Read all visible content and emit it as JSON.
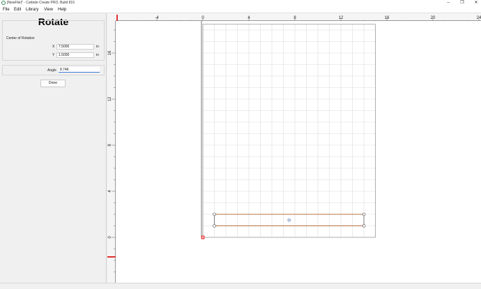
{
  "window": {
    "title": "[NewFile]* - Carbide Create PRO, Build 815",
    "minimize_glyph": "–",
    "maximize_glyph": "❐",
    "close_glyph": "✕"
  },
  "menu": {
    "items": [
      {
        "label": "File",
        "name": "menu-file"
      },
      {
        "label": "Edit",
        "name": "menu-edit"
      },
      {
        "label": "Library",
        "name": "menu-library"
      },
      {
        "label": "View",
        "name": "menu-view"
      },
      {
        "label": "Help",
        "name": "menu-help"
      }
    ]
  },
  "rotate_panel": {
    "title": "Rotate",
    "center_of_rotation_label": "Center of Rotation",
    "x_label": "X",
    "x_value": "7.5000",
    "y_label": "Y",
    "y_value": "1.5000",
    "unit": "in",
    "angle_label": "Angle",
    "angle_value": "8.746",
    "done_label": "Done"
  },
  "rulers": {
    "top_labels": [
      "-4",
      "0",
      "4",
      "8",
      "12",
      "16",
      "20",
      "24"
    ],
    "top_values": [
      -4,
      0,
      4,
      8,
      12,
      16,
      20,
      24
    ],
    "left_labels": [
      "16",
      "12",
      "8",
      "4",
      "0"
    ],
    "left_values": [
      16,
      12,
      8,
      4,
      0
    ]
  },
  "colors": {
    "grid_line": "#dcdcdc",
    "stock_outline": "#9a9a9a",
    "selection_dash": "#e06b20",
    "origin_marker": "#e03030",
    "ruler_marker": "#e03030"
  },
  "stock": {
    "width_in": 15,
    "height_in": 18.5
  },
  "selected_rectangle": {
    "x_min": 1,
    "x_max": 14,
    "y_min": 1,
    "y_max": 2,
    "center_x": 7.5,
    "center_y": 1.5
  }
}
